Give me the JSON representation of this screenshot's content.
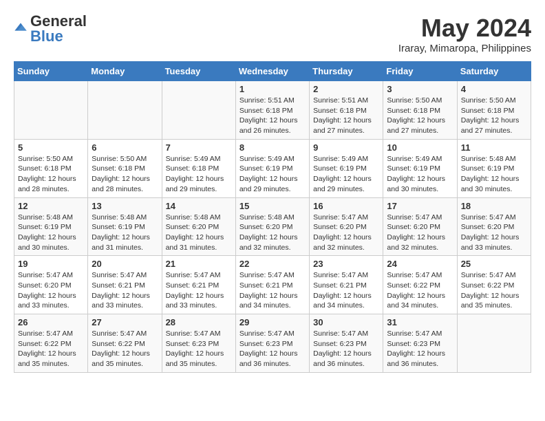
{
  "header": {
    "logo_general": "General",
    "logo_blue": "Blue",
    "month_title": "May 2024",
    "location": "Iraray, Mimaropa, Philippines"
  },
  "columns": [
    "Sunday",
    "Monday",
    "Tuesday",
    "Wednesday",
    "Thursday",
    "Friday",
    "Saturday"
  ],
  "weeks": [
    [
      {
        "day": "",
        "info": ""
      },
      {
        "day": "",
        "info": ""
      },
      {
        "day": "",
        "info": ""
      },
      {
        "day": "1",
        "info": "Sunrise: 5:51 AM\nSunset: 6:18 PM\nDaylight: 12 hours and 26 minutes."
      },
      {
        "day": "2",
        "info": "Sunrise: 5:51 AM\nSunset: 6:18 PM\nDaylight: 12 hours and 27 minutes."
      },
      {
        "day": "3",
        "info": "Sunrise: 5:50 AM\nSunset: 6:18 PM\nDaylight: 12 hours and 27 minutes."
      },
      {
        "day": "4",
        "info": "Sunrise: 5:50 AM\nSunset: 6:18 PM\nDaylight: 12 hours and 27 minutes."
      }
    ],
    [
      {
        "day": "5",
        "info": "Sunrise: 5:50 AM\nSunset: 6:18 PM\nDaylight: 12 hours and 28 minutes."
      },
      {
        "day": "6",
        "info": "Sunrise: 5:50 AM\nSunset: 6:18 PM\nDaylight: 12 hours and 28 minutes."
      },
      {
        "day": "7",
        "info": "Sunrise: 5:49 AM\nSunset: 6:18 PM\nDaylight: 12 hours and 29 minutes."
      },
      {
        "day": "8",
        "info": "Sunrise: 5:49 AM\nSunset: 6:19 PM\nDaylight: 12 hours and 29 minutes."
      },
      {
        "day": "9",
        "info": "Sunrise: 5:49 AM\nSunset: 6:19 PM\nDaylight: 12 hours and 29 minutes."
      },
      {
        "day": "10",
        "info": "Sunrise: 5:49 AM\nSunset: 6:19 PM\nDaylight: 12 hours and 30 minutes."
      },
      {
        "day": "11",
        "info": "Sunrise: 5:48 AM\nSunset: 6:19 PM\nDaylight: 12 hours and 30 minutes."
      }
    ],
    [
      {
        "day": "12",
        "info": "Sunrise: 5:48 AM\nSunset: 6:19 PM\nDaylight: 12 hours and 30 minutes."
      },
      {
        "day": "13",
        "info": "Sunrise: 5:48 AM\nSunset: 6:19 PM\nDaylight: 12 hours and 31 minutes."
      },
      {
        "day": "14",
        "info": "Sunrise: 5:48 AM\nSunset: 6:20 PM\nDaylight: 12 hours and 31 minutes."
      },
      {
        "day": "15",
        "info": "Sunrise: 5:48 AM\nSunset: 6:20 PM\nDaylight: 12 hours and 32 minutes."
      },
      {
        "day": "16",
        "info": "Sunrise: 5:47 AM\nSunset: 6:20 PM\nDaylight: 12 hours and 32 minutes."
      },
      {
        "day": "17",
        "info": "Sunrise: 5:47 AM\nSunset: 6:20 PM\nDaylight: 12 hours and 32 minutes."
      },
      {
        "day": "18",
        "info": "Sunrise: 5:47 AM\nSunset: 6:20 PM\nDaylight: 12 hours and 33 minutes."
      }
    ],
    [
      {
        "day": "19",
        "info": "Sunrise: 5:47 AM\nSunset: 6:20 PM\nDaylight: 12 hours and 33 minutes."
      },
      {
        "day": "20",
        "info": "Sunrise: 5:47 AM\nSunset: 6:21 PM\nDaylight: 12 hours and 33 minutes."
      },
      {
        "day": "21",
        "info": "Sunrise: 5:47 AM\nSunset: 6:21 PM\nDaylight: 12 hours and 33 minutes."
      },
      {
        "day": "22",
        "info": "Sunrise: 5:47 AM\nSunset: 6:21 PM\nDaylight: 12 hours and 34 minutes."
      },
      {
        "day": "23",
        "info": "Sunrise: 5:47 AM\nSunset: 6:21 PM\nDaylight: 12 hours and 34 minutes."
      },
      {
        "day": "24",
        "info": "Sunrise: 5:47 AM\nSunset: 6:22 PM\nDaylight: 12 hours and 34 minutes."
      },
      {
        "day": "25",
        "info": "Sunrise: 5:47 AM\nSunset: 6:22 PM\nDaylight: 12 hours and 35 minutes."
      }
    ],
    [
      {
        "day": "26",
        "info": "Sunrise: 5:47 AM\nSunset: 6:22 PM\nDaylight: 12 hours and 35 minutes."
      },
      {
        "day": "27",
        "info": "Sunrise: 5:47 AM\nSunset: 6:22 PM\nDaylight: 12 hours and 35 minutes."
      },
      {
        "day": "28",
        "info": "Sunrise: 5:47 AM\nSunset: 6:23 PM\nDaylight: 12 hours and 35 minutes."
      },
      {
        "day": "29",
        "info": "Sunrise: 5:47 AM\nSunset: 6:23 PM\nDaylight: 12 hours and 36 minutes."
      },
      {
        "day": "30",
        "info": "Sunrise: 5:47 AM\nSunset: 6:23 PM\nDaylight: 12 hours and 36 minutes."
      },
      {
        "day": "31",
        "info": "Sunrise: 5:47 AM\nSunset: 6:23 PM\nDaylight: 12 hours and 36 minutes."
      },
      {
        "day": "",
        "info": ""
      }
    ]
  ]
}
